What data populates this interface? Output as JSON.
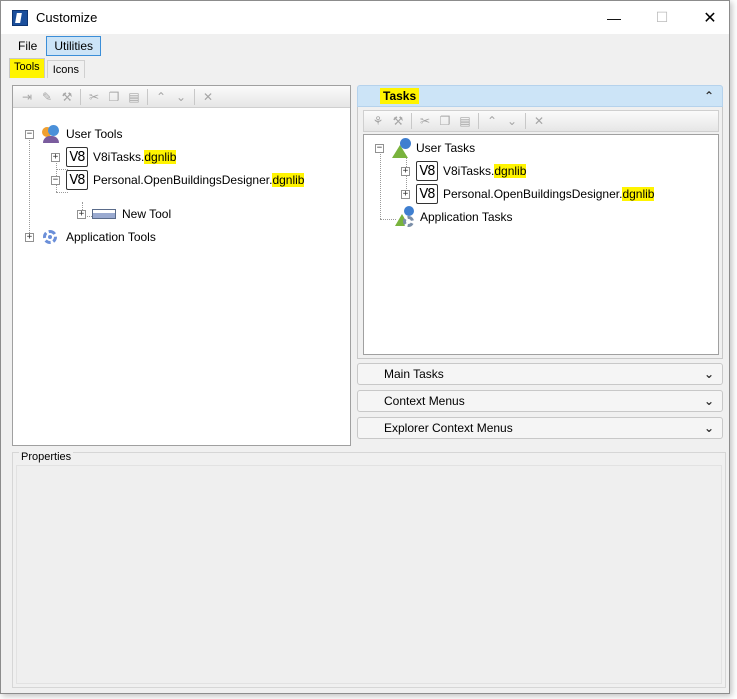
{
  "window": {
    "title": "Customize",
    "controls": {
      "minimize": "—",
      "maximize": "☐",
      "close": "✕"
    }
  },
  "menu": [
    {
      "label": "File",
      "active": false
    },
    {
      "label": "Utilities",
      "active": true
    }
  ],
  "tabs": [
    {
      "label": "Tools",
      "selected": true
    },
    {
      "label": "Icons",
      "selected": false
    }
  ],
  "tools_toolbar": [
    "arrow-right-icon",
    "wrench-icon",
    "tool-edit-icon",
    "cut-icon",
    "copy-icon",
    "paste-icon",
    "move-up-icon",
    "move-down-icon",
    "delete-icon"
  ],
  "tools_tree": {
    "user_tools": "User Tools",
    "v8i_lib": {
      "name": "V8iTasks.",
      "ext": "dgnlib"
    },
    "personal_lib": {
      "name": "Personal.OpenBuildingsDesigner.",
      "ext": "dgnlib"
    },
    "new_tool": "New Tool",
    "application_tools": "Application Tools",
    "v8_badge": "V8"
  },
  "tasks_panel": {
    "title": "Tasks",
    "user_tasks": "User Tasks",
    "v8i_lib": {
      "name": "V8iTasks.",
      "ext": "dgnlib"
    },
    "personal_lib": {
      "name": "Personal.OpenBuildingsDesigner.",
      "ext": "dgnlib"
    },
    "application_tasks": "Application Tasks"
  },
  "collapsed_panels": [
    {
      "label": "Main Tasks"
    },
    {
      "label": "Context Menus"
    },
    {
      "label": "Explorer Context Menus"
    }
  ],
  "properties": {
    "label": "Properties"
  },
  "colors": {
    "highlight": "#fff400",
    "active_blue": "#cce4f7"
  }
}
